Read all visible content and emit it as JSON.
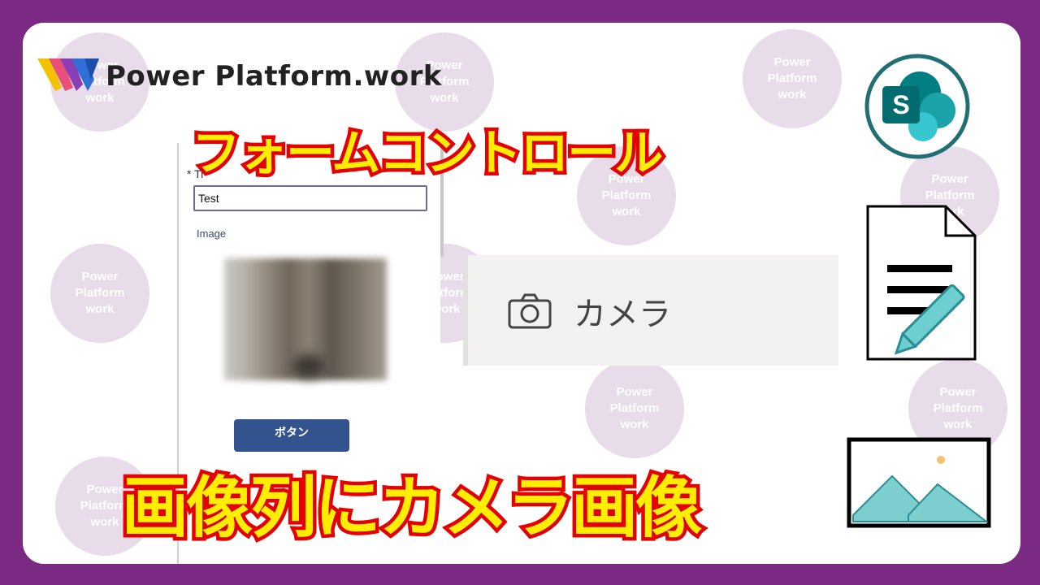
{
  "brand": {
    "name": "Power Platform.work"
  },
  "watermark": {
    "text": "Power\nPlatform\nwork"
  },
  "titles": {
    "top": "フォームコントロール",
    "bottom": "画像列にカメラ画像"
  },
  "form": {
    "required_label": "* Ti",
    "title_value": "Test",
    "image_label": "Image",
    "button_label": "ボタン"
  },
  "camera": {
    "label": "カメラ"
  },
  "icons": [
    "logo-icon",
    "sharepoint-icon",
    "camera-icon",
    "document-edit-icon",
    "image-icon"
  ],
  "colors": {
    "frame": "#7b2a83",
    "title_fill": "#ffee00",
    "title_stroke": "#e60000",
    "button": "#33538f",
    "teal": "#2aa0a4"
  }
}
